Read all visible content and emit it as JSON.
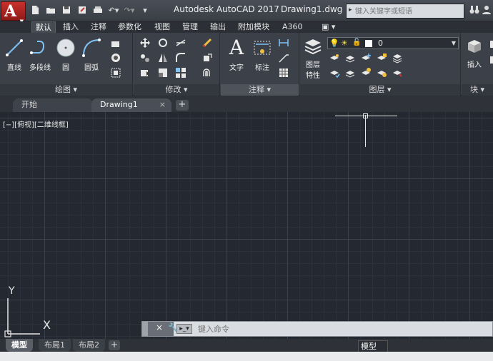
{
  "title": {
    "app_logo": "A",
    "app_name": "Autodesk AutoCAD 2017",
    "document": "Drawing1.dwg",
    "search_placeholder": "键入关键字或短语"
  },
  "ribbon_tabs": [
    "默认",
    "插入",
    "注释",
    "参数化",
    "视图",
    "管理",
    "输出",
    "附加模块",
    "A360",
    "▣ ▾"
  ],
  "draw_panel": {
    "title": "绘图 ▾",
    "tools": [
      "直线",
      "多段线",
      "圆",
      "圆弧"
    ]
  },
  "modify_panel": {
    "title": "修改 ▾"
  },
  "annotation_panel": {
    "title": "注释 ▾",
    "tools": [
      "文字",
      "标注"
    ]
  },
  "layers_panel": {
    "title": "图层 ▾",
    "properties_label_line1": "图层",
    "properties_label_line2": "特性",
    "current_layer": "0"
  },
  "block_panel": {
    "title": "块 ▾",
    "insert_label": "插入"
  },
  "file_tabs": {
    "start": "开始",
    "drawing": "Drawing1",
    "close": "×",
    "new": "+"
  },
  "viewport": {
    "label": "[−][俯视][二维线框]",
    "ucs_x": "X",
    "ucs_y": "Y"
  },
  "command_line": {
    "close": "×",
    "customize": "🔧",
    "prompt_icon": "▸_▾",
    "placeholder": "键入命令"
  },
  "layout_tabs": [
    "模型",
    "布局1",
    "布局2"
  ],
  "layout_add": "+",
  "status": {
    "model_space": "模型"
  },
  "colors": {
    "canvas": "#232831",
    "ribbon": "#3c4048",
    "logo": "#c9302c"
  }
}
